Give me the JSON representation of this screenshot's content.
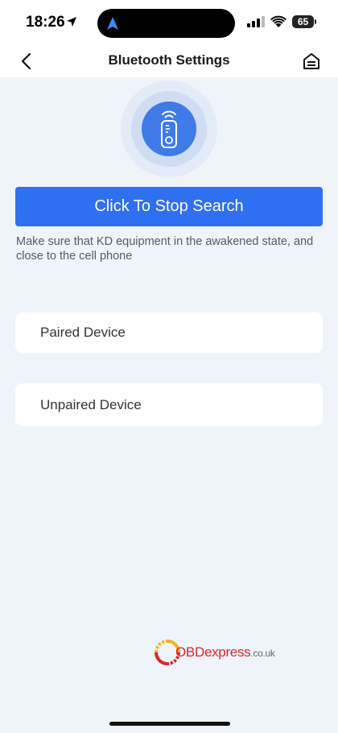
{
  "status_bar": {
    "time": "18:26",
    "battery": "65"
  },
  "nav": {
    "title": "Bluetooth Settings",
    "back_icon": "chevron-left-icon",
    "home_icon": "home-icon"
  },
  "main": {
    "remote_icon": "remote-key-icon",
    "search_button": "Click To Stop Search",
    "hint": "Make sure that KD equipment in the awakened state, and close to the cell phone",
    "devices": [
      {
        "label": "Paired Device"
      },
      {
        "label": "Unpaired Device"
      }
    ]
  },
  "watermark": {
    "brand": "OBDexpress",
    "domain": ".co.uk"
  },
  "colors": {
    "accent": "#2f6ff1",
    "background": "#eff4fb",
    "card": "#ffffff"
  }
}
